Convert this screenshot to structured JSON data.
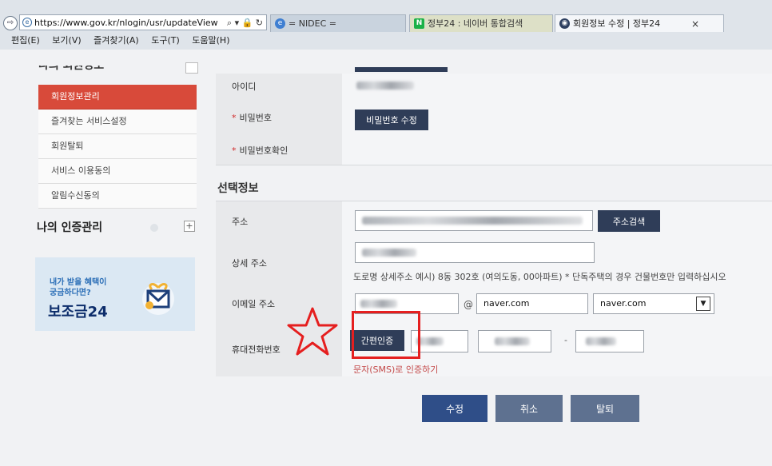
{
  "browser": {
    "url": "https://www.gov.kr/nlogin/usr/updateView",
    "address_icons": "⌕ ▾ 🔒 ↻",
    "tabs": [
      {
        "label": "= NIDEC ="
      },
      {
        "label": "정부24 : 네이버 통합검색"
      },
      {
        "label": "회원정보 수정 | 정부24"
      }
    ],
    "tab2_icon": "N",
    "close_icon": "×",
    "menu": [
      "편집(E)",
      "보기(V)",
      "즐겨찾기(A)",
      "도구(T)",
      "도움말(H)"
    ]
  },
  "sidebar": {
    "heading": "나의 회원정보",
    "items": [
      {
        "label": "회원정보관리",
        "active": true
      },
      {
        "label": "즐겨찾는 서비스설정"
      },
      {
        "label": "회원탈퇴"
      },
      {
        "label": "서비스 이용동의"
      },
      {
        "label": "알림수신동의"
      }
    ],
    "auth_title": "나의 인증관리",
    "auth_plus": "+",
    "banner": {
      "line1": "내가 받을 혜택이",
      "line2": "궁금하다면?",
      "logo": "보조금24"
    }
  },
  "form": {
    "id_label": "아이디",
    "password_label": "비밀번호",
    "password_button": "비밀번호 수정",
    "password_confirm_label": "비밀번호확인",
    "required_mark": "*",
    "optional_section": "선택정보",
    "address_label": "주소",
    "address_search_button": "주소검색",
    "detail_address_label": "상세 주소",
    "detail_address_hint": "도로명 상세주소 예시) 8동 302호 (여의도동, 00아파트) * 단독주택의 경우 건물번호만 입력하십시오",
    "email_label": "이메일 주소",
    "email_at": "@",
    "email_domain": "naver.com",
    "email_domain_select": "naver.com",
    "phone_label": "휴대전화번호",
    "simple_auth_button": "간편인증",
    "phone_separator": "-",
    "sms_link": "문자(SMS)로 인증하기"
  },
  "actions": {
    "submit": "수정",
    "cancel": "취소",
    "withdraw": "탈퇴"
  },
  "colors": {
    "active_menu": "#d84a3a",
    "dark_button": "#2f3d58",
    "primary_button": "#2f4e88",
    "annotation_red": "#e51f1f"
  }
}
